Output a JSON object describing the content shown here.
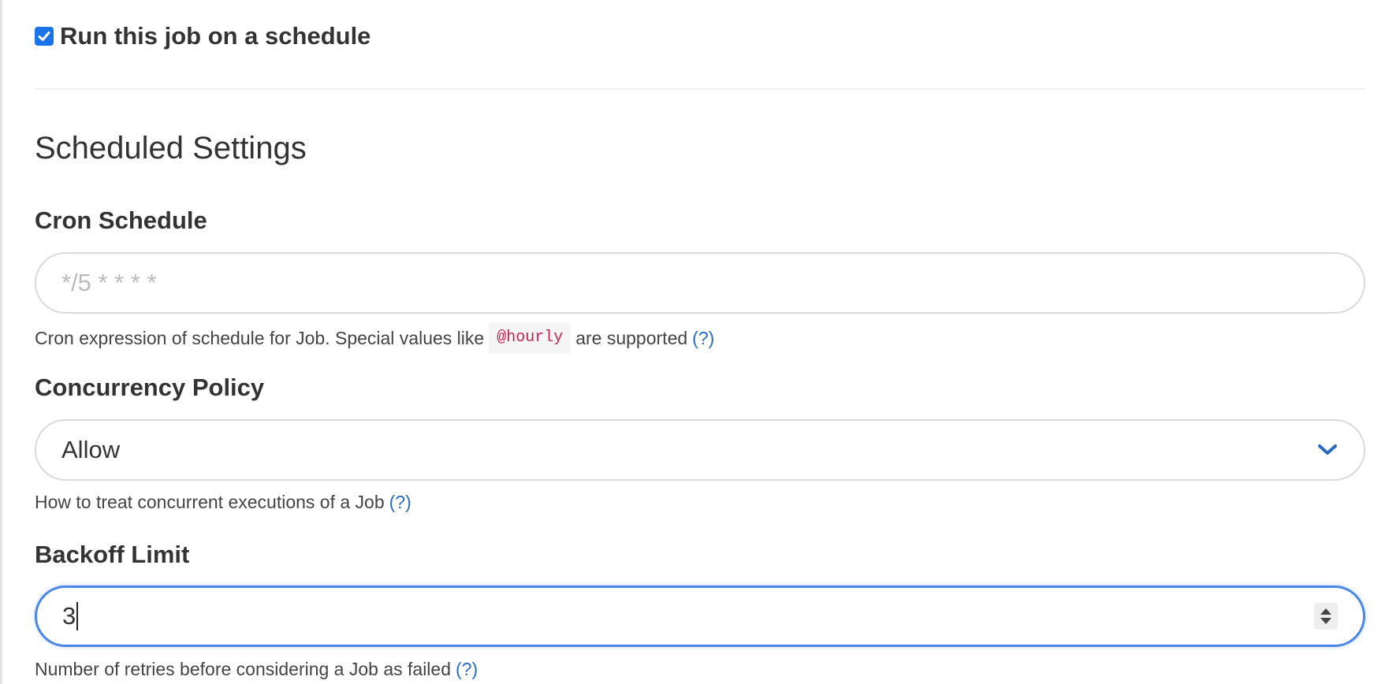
{
  "schedule_toggle": {
    "label": "Run this job on a schedule",
    "checked": true
  },
  "section": {
    "title": "Scheduled Settings"
  },
  "cron": {
    "label": "Cron Schedule",
    "placeholder": "*/5 * * * *",
    "value": "",
    "help_prefix": "Cron expression of schedule for Job. Special values like",
    "help_code": "@hourly",
    "help_suffix": "are supported",
    "help_link": "(?)"
  },
  "concurrency": {
    "label": "Concurrency Policy",
    "selected": "Allow",
    "help": "How to treat concurrent executions of a Job",
    "help_link": "(?)"
  },
  "backoff": {
    "label": "Backoff Limit",
    "value": "3",
    "help": "Number of retries before considering a Job as failed",
    "help_link": "(?)"
  },
  "colors": {
    "accent": "#1a73e8",
    "link": "#2a6bc2",
    "code": "#c7254e",
    "focus_border": "#4a86e8"
  },
  "icons": {
    "checkbox": "checkmark-icon",
    "select": "chevron-down-icon",
    "stepper": "stepper-arrows-icon"
  }
}
